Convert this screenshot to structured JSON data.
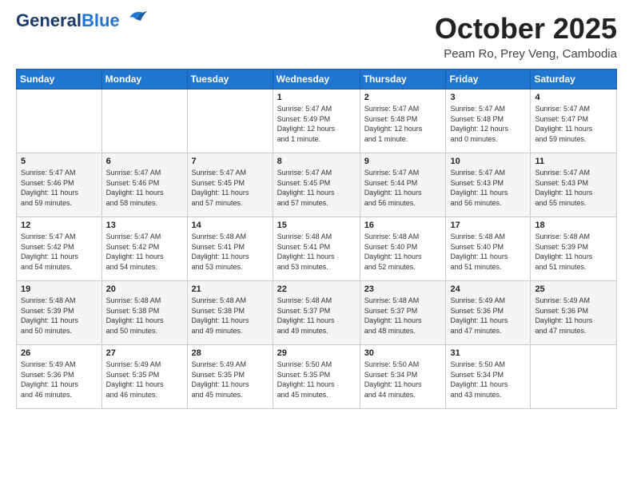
{
  "header": {
    "logo_line1": "General",
    "logo_line2": "Blue",
    "month": "October 2025",
    "location": "Peam Ro, Prey Veng, Cambodia"
  },
  "weekdays": [
    "Sunday",
    "Monday",
    "Tuesday",
    "Wednesday",
    "Thursday",
    "Friday",
    "Saturday"
  ],
  "weeks": [
    [
      {
        "day": "",
        "info": ""
      },
      {
        "day": "",
        "info": ""
      },
      {
        "day": "",
        "info": ""
      },
      {
        "day": "1",
        "info": "Sunrise: 5:47 AM\nSunset: 5:49 PM\nDaylight: 12 hours\nand 1 minute."
      },
      {
        "day": "2",
        "info": "Sunrise: 5:47 AM\nSunset: 5:48 PM\nDaylight: 12 hours\nand 1 minute."
      },
      {
        "day": "3",
        "info": "Sunrise: 5:47 AM\nSunset: 5:48 PM\nDaylight: 12 hours\nand 0 minutes."
      },
      {
        "day": "4",
        "info": "Sunrise: 5:47 AM\nSunset: 5:47 PM\nDaylight: 11 hours\nand 59 minutes."
      }
    ],
    [
      {
        "day": "5",
        "info": "Sunrise: 5:47 AM\nSunset: 5:46 PM\nDaylight: 11 hours\nand 59 minutes."
      },
      {
        "day": "6",
        "info": "Sunrise: 5:47 AM\nSunset: 5:46 PM\nDaylight: 11 hours\nand 58 minutes."
      },
      {
        "day": "7",
        "info": "Sunrise: 5:47 AM\nSunset: 5:45 PM\nDaylight: 11 hours\nand 57 minutes."
      },
      {
        "day": "8",
        "info": "Sunrise: 5:47 AM\nSunset: 5:45 PM\nDaylight: 11 hours\nand 57 minutes."
      },
      {
        "day": "9",
        "info": "Sunrise: 5:47 AM\nSunset: 5:44 PM\nDaylight: 11 hours\nand 56 minutes."
      },
      {
        "day": "10",
        "info": "Sunrise: 5:47 AM\nSunset: 5:43 PM\nDaylight: 11 hours\nand 56 minutes."
      },
      {
        "day": "11",
        "info": "Sunrise: 5:47 AM\nSunset: 5:43 PM\nDaylight: 11 hours\nand 55 minutes."
      }
    ],
    [
      {
        "day": "12",
        "info": "Sunrise: 5:47 AM\nSunset: 5:42 PM\nDaylight: 11 hours\nand 54 minutes."
      },
      {
        "day": "13",
        "info": "Sunrise: 5:47 AM\nSunset: 5:42 PM\nDaylight: 11 hours\nand 54 minutes."
      },
      {
        "day": "14",
        "info": "Sunrise: 5:48 AM\nSunset: 5:41 PM\nDaylight: 11 hours\nand 53 minutes."
      },
      {
        "day": "15",
        "info": "Sunrise: 5:48 AM\nSunset: 5:41 PM\nDaylight: 11 hours\nand 53 minutes."
      },
      {
        "day": "16",
        "info": "Sunrise: 5:48 AM\nSunset: 5:40 PM\nDaylight: 11 hours\nand 52 minutes."
      },
      {
        "day": "17",
        "info": "Sunrise: 5:48 AM\nSunset: 5:40 PM\nDaylight: 11 hours\nand 51 minutes."
      },
      {
        "day": "18",
        "info": "Sunrise: 5:48 AM\nSunset: 5:39 PM\nDaylight: 11 hours\nand 51 minutes."
      }
    ],
    [
      {
        "day": "19",
        "info": "Sunrise: 5:48 AM\nSunset: 5:39 PM\nDaylight: 11 hours\nand 50 minutes."
      },
      {
        "day": "20",
        "info": "Sunrise: 5:48 AM\nSunset: 5:38 PM\nDaylight: 11 hours\nand 50 minutes."
      },
      {
        "day": "21",
        "info": "Sunrise: 5:48 AM\nSunset: 5:38 PM\nDaylight: 11 hours\nand 49 minutes."
      },
      {
        "day": "22",
        "info": "Sunrise: 5:48 AM\nSunset: 5:37 PM\nDaylight: 11 hours\nand 49 minutes."
      },
      {
        "day": "23",
        "info": "Sunrise: 5:48 AM\nSunset: 5:37 PM\nDaylight: 11 hours\nand 48 minutes."
      },
      {
        "day": "24",
        "info": "Sunrise: 5:49 AM\nSunset: 5:36 PM\nDaylight: 11 hours\nand 47 minutes."
      },
      {
        "day": "25",
        "info": "Sunrise: 5:49 AM\nSunset: 5:36 PM\nDaylight: 11 hours\nand 47 minutes."
      }
    ],
    [
      {
        "day": "26",
        "info": "Sunrise: 5:49 AM\nSunset: 5:36 PM\nDaylight: 11 hours\nand 46 minutes."
      },
      {
        "day": "27",
        "info": "Sunrise: 5:49 AM\nSunset: 5:35 PM\nDaylight: 11 hours\nand 46 minutes."
      },
      {
        "day": "28",
        "info": "Sunrise: 5:49 AM\nSunset: 5:35 PM\nDaylight: 11 hours\nand 45 minutes."
      },
      {
        "day": "29",
        "info": "Sunrise: 5:50 AM\nSunset: 5:35 PM\nDaylight: 11 hours\nand 45 minutes."
      },
      {
        "day": "30",
        "info": "Sunrise: 5:50 AM\nSunset: 5:34 PM\nDaylight: 11 hours\nand 44 minutes."
      },
      {
        "day": "31",
        "info": "Sunrise: 5:50 AM\nSunset: 5:34 PM\nDaylight: 11 hours\nand 43 minutes."
      },
      {
        "day": "",
        "info": ""
      }
    ]
  ]
}
